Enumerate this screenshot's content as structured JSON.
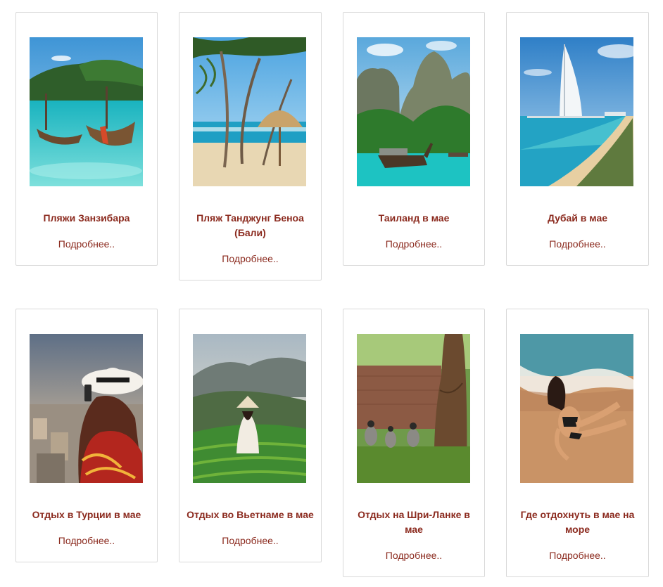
{
  "cards": [
    {
      "title": "Пляжи Занзибара",
      "link": "Подробнее.."
    },
    {
      "title": "Пляж Танджунг Беноа (Бали)",
      "link": "Подробнее.."
    },
    {
      "title": "Таиланд в мае",
      "link": "Подробнее.."
    },
    {
      "title": "Дубай в мае",
      "link": "Подробнее.."
    },
    {
      "title": "Отдых в Турции в мае",
      "link": "Подробнее.."
    },
    {
      "title": "Отдых во Вьетнаме в мае",
      "link": "Подробнее.."
    },
    {
      "title": "Отдых на Шри-Ланке в мае",
      "link": "Подробнее.."
    },
    {
      "title": "Где отдохнуть в мае на море",
      "link": "Подробнее.."
    }
  ],
  "colors": {
    "accent": "#8b2a1e",
    "border": "#d9d9d9"
  }
}
